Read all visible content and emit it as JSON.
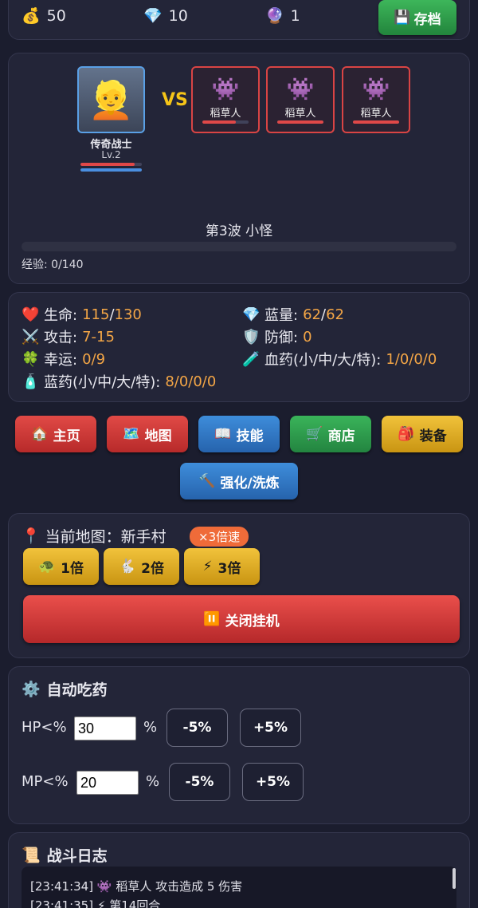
{
  "resources": {
    "gold": {
      "icon": "💰",
      "value": "50"
    },
    "diamond": {
      "icon": "💎",
      "value": "10"
    },
    "orb": {
      "icon": "🔮",
      "value": "1"
    }
  },
  "save_button": {
    "icon": "💾",
    "label": "存档"
  },
  "battle": {
    "hero": {
      "avatar": "👱",
      "name": "传奇战士",
      "level": "Lv.2",
      "hp_ratio": 0.88,
      "mp_ratio": 1.0
    },
    "vs": "VS",
    "enemies": [
      {
        "icon": "👾",
        "name": "稻草人",
        "hp_ratio": 0.72
      },
      {
        "icon": "👾",
        "name": "稻草人",
        "hp_ratio": 1.0
      },
      {
        "icon": "👾",
        "name": "稻草人",
        "hp_ratio": 1.0
      }
    ],
    "wave": "第3波 小怪",
    "xp_ratio": 0,
    "xp_text": "经验: 0/140"
  },
  "stats": {
    "hp": {
      "icon": "❤️",
      "label": "生命: ",
      "cur": "115",
      "sep": "/",
      "max": "130"
    },
    "mp": {
      "icon": "💎",
      "label": "蓝量: ",
      "cur": "62",
      "sep": "/",
      "max": "62"
    },
    "atk": {
      "icon": "⚔️",
      "label": "攻击: ",
      "value": "7-15"
    },
    "def": {
      "icon": "🛡️",
      "label": "防御: ",
      "value": "0"
    },
    "luck": {
      "icon": "🍀",
      "label": "幸运: ",
      "value": "0/9"
    },
    "hp_potions": {
      "icon": "🧪",
      "label": "血药(小/中/大/特): ",
      "value": "1/0/0/0"
    },
    "mp_potions": {
      "icon": "🧴",
      "label": "蓝药(小/中/大/特): ",
      "value": "8/0/0/0"
    }
  },
  "nav": {
    "home": {
      "icon": "🏠",
      "label": "主页"
    },
    "map": {
      "icon": "🗺️",
      "label": "地图"
    },
    "skills": {
      "icon": "📖",
      "label": "技能"
    },
    "shop": {
      "icon": "🛒",
      "label": "商店"
    },
    "equip": {
      "icon": "🎒",
      "label": "装备"
    },
    "enhance": {
      "icon": "🔨",
      "label": "强化/洗炼"
    }
  },
  "map_panel": {
    "pin_icon": "📍",
    "title": "当前地图：新手村",
    "speed_badge": "×3倍速",
    "speeds": [
      {
        "icon": "🐢",
        "label": "1倍"
      },
      {
        "icon": "🐇",
        "label": "2倍"
      },
      {
        "icon": "⚡",
        "label": "3倍"
      }
    ],
    "stop": {
      "icon": "⏸️",
      "label": "关闭挂机"
    }
  },
  "auto_potion": {
    "icon": "⚙️",
    "title": "自动吃药",
    "hp": {
      "label": "HP<%",
      "value": "30",
      "unit": "%",
      "minus": "-5%",
      "plus": "+5%"
    },
    "mp": {
      "label": "MP<%",
      "value": "20",
      "unit": "%",
      "minus": "-5%",
      "plus": "+5%"
    }
  },
  "battle_log": {
    "icon": "📜",
    "title": "战斗日志",
    "lines": [
      {
        "time": "[23:41:34]",
        "icon": "👾",
        "text": "稻草人 攻击造成 5 伤害"
      },
      {
        "time": "[23:41:35]",
        "icon": "⚡",
        "text": "第14回合"
      }
    ]
  },
  "colors": {
    "background": "#1b1d2e",
    "card": "#232538",
    "accent_orange": "#f4a646",
    "hp_red": "#e04848",
    "mp_blue": "#4a8fe0",
    "vs_yellow": "#f5c518"
  }
}
